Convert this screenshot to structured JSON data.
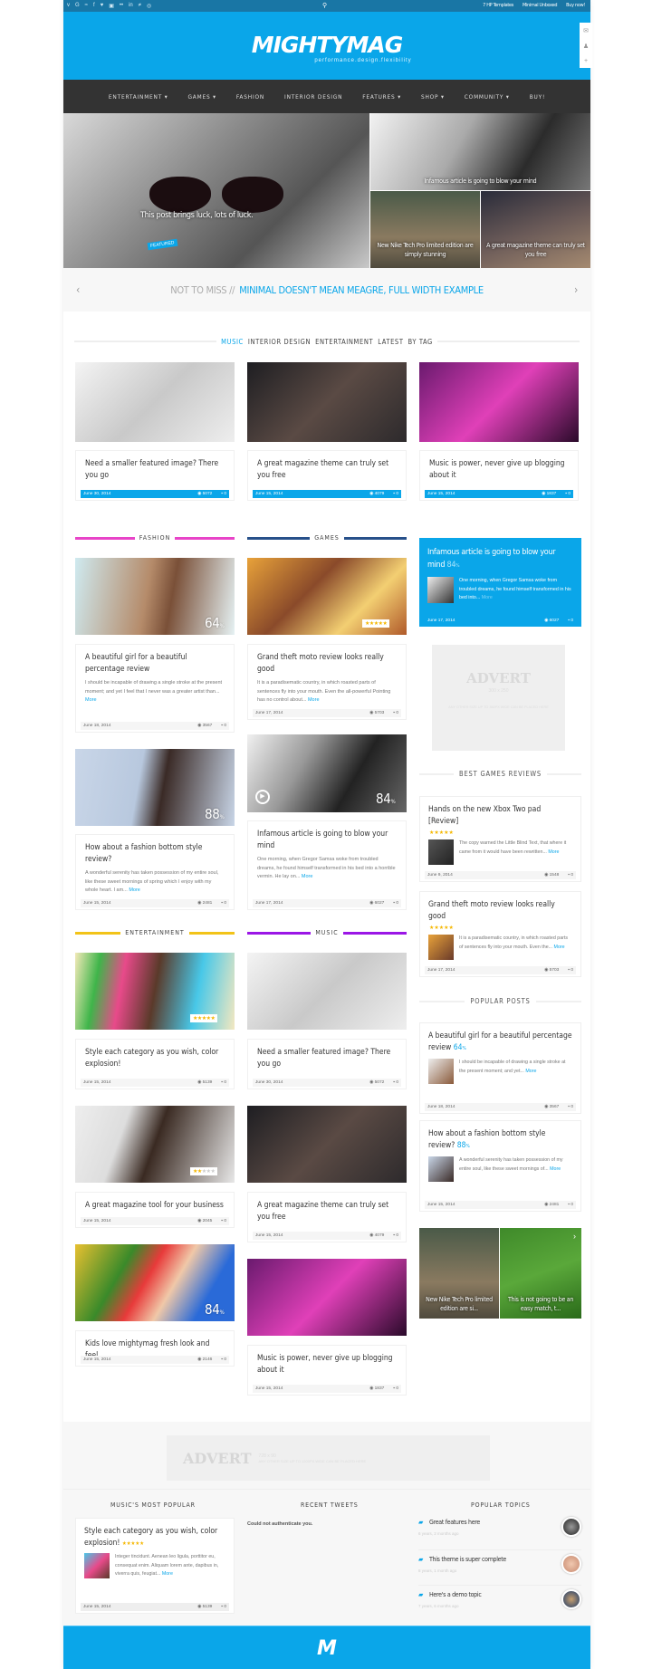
{
  "topbar": {
    "social_icons": [
      "vimeo-icon",
      "google-icon",
      "rss-icon",
      "facebook-icon",
      "twitter-icon",
      "youtube-icon",
      "flickr-icon",
      "linkedin-icon",
      "delicious-icon",
      "dribbble-icon"
    ],
    "links": [
      "7 HP Templates",
      "Minimal Unboxed",
      "Buy now!"
    ]
  },
  "header": {
    "logo": "MIGHTYMAG",
    "tagline": "performance.design.flexibility"
  },
  "nav": [
    "ENTERTAINMENT ▾",
    "GAMES ▾",
    "FASHION",
    "INTERIOR DESIGN",
    "FEATURES ▾",
    "SHOP ▾",
    "COMMUNITY ▾",
    "BUY!"
  ],
  "hero": {
    "main": {
      "badge": "FEATURED",
      "title": "This post brings luck, lots of luck."
    },
    "top_right": "Infamous article is going to blow your mind",
    "bottom_left": "New Nike Tech Pro limited edition are simply stunning",
    "bottom_right": "A great magazine theme can truly set you free"
  },
  "not_to_miss": {
    "label": "NOT TO MISS //",
    "title": "MINIMAL DOESN'T MEAN MEAGRE, FULL WIDTH EXAMPLE"
  },
  "tabs": [
    {
      "label": "MUSIC",
      "active": true
    },
    {
      "label": "INTERIOR DESIGN"
    },
    {
      "label": "ENTERTAINMENT"
    },
    {
      "label": "LATEST"
    },
    {
      "label": "BY TAG"
    }
  ],
  "tab_cards": [
    {
      "title": "Need a smaller featured image? There you go",
      "date": "June 30, 2014",
      "views": "5072",
      "comments": "0"
    },
    {
      "title": "A great magazine theme can truly set you free",
      "date": "June 15, 2014",
      "views": "4079",
      "comments": "0"
    },
    {
      "title": "Music is power, never give up blogging about it",
      "date": "June 15, 2014",
      "views": "1837",
      "comments": "0"
    }
  ],
  "sections": {
    "fashion": {
      "label": "FASHION",
      "color": "#e844c8"
    },
    "games": {
      "label": "GAMES",
      "color": "#27508a"
    },
    "entertainment": {
      "label": "ENTERTAINMENT",
      "color": "#f2c318"
    },
    "music": {
      "label": "MUSIC",
      "color": "#9b16e6"
    }
  },
  "posts": {
    "fashion1": {
      "title": "A beautiful girl for a beautiful percentage review",
      "excerpt": "I should be incapable of drawing a single stroke at the present moment; and yet I feel that I never was a greater artist than...",
      "date": "June 18, 2014",
      "views": "3567",
      "comments": "0",
      "score": "64"
    },
    "fashion2": {
      "title": "How about a fashion bottom style review?",
      "excerpt": "A wonderful serenity has taken possession of my entire soul, like these sweet mornings of spring which I enjoy with my whole heart. I am...",
      "date": "June 15, 2014",
      "views": "2481",
      "comments": "0",
      "score": "88"
    },
    "games1": {
      "title": "Grand theft moto review looks really good",
      "excerpt": "It is a paradisematic country, in which roasted parts of sentences fly into your mouth. Even the all-powerful Pointing has no control about...",
      "date": "June 17, 2014",
      "views": "5703",
      "comments": "0",
      "stars": 4.5
    },
    "games2": {
      "title": "Infamous article is going to blow your mind",
      "excerpt": "One morning, when Gregor Samsa woke from troubled dreams, he found himself transformed in his bed into a horrible vermin. He lay on...",
      "date": "June 17, 2014",
      "views": "6027",
      "comments": "0",
      "score": "84"
    },
    "ent1": {
      "title": "Style each category as you wish, color explosion!",
      "date": "June 15, 2014",
      "views": "5139",
      "comments": "0",
      "stars": 5
    },
    "ent2": {
      "title": "A great magazine tool for your business",
      "date": "June 15, 2014",
      "views": "2045",
      "comments": "0",
      "stars": 2
    },
    "ent3": {
      "title": "Kids love mightymag fresh look and feel",
      "date": "June 15, 2014",
      "views": "2146",
      "comments": "0",
      "score": "84"
    },
    "music1": {
      "title": "Need a smaller featured image? There you go",
      "date": "June 30, 2014",
      "views": "5072",
      "comments": "0"
    },
    "music2": {
      "title": "A great magazine theme can truly set you free",
      "date": "June 15, 2014",
      "views": "4079",
      "comments": "0"
    },
    "music3": {
      "title": "Music is power, never give up blogging about it",
      "date": "June 15, 2014",
      "views": "1837",
      "comments": "0"
    }
  },
  "more_label": "More",
  "pct_sign": "%",
  "sidebar": {
    "featured": {
      "title": "Infamous article is going to blow your mind",
      "score": "84",
      "excerpt": "One morning, when Gregor Samsa woke from troubled dreams, he found himself transformed in his bed into...",
      "date": "June 17, 2014",
      "views": "6027",
      "comments": "0"
    },
    "advert": {
      "title": "ADVERT",
      "size": "300 x 250",
      "note": "ANY OTHER SIZE UP TO 360PX WIDE CAN BE PLACED HERE"
    },
    "best_games_title": "BEST GAMES REVIEWS",
    "best_games": [
      {
        "title": "Hands on the new Xbox Two pad [Review]",
        "stars": 4.5,
        "excerpt": "The copy warned the Little Blind Text, that where it came from it would have been rewritten...",
        "date": "June 9, 2014",
        "views": "1548",
        "comments": "0"
      },
      {
        "title": "Grand theft moto review looks really good",
        "stars": 4.5,
        "excerpt": "It is a paradisematic country, in which roasted parts of sentences fly into your mouth. Even the...",
        "date": "June 17, 2014",
        "views": "5703",
        "comments": "0"
      }
    ],
    "popular_title": "POPULAR POSTS",
    "popular": [
      {
        "title": "A beautiful girl for a beautiful percentage review",
        "score": "64",
        "excerpt": "I should be incapable of drawing a single stroke at the present moment; and yet...",
        "date": "June 18, 2014",
        "views": "3567",
        "comments": "0"
      },
      {
        "title": "How about a fashion bottom style review?",
        "score": "88",
        "excerpt": "A wonderful serenity has taken possession of my entire soul, like these sweet mornings of...",
        "date": "June 15, 2014",
        "views": "2481",
        "comments": "0"
      }
    ],
    "slider": [
      "New Nike Tech Pro limited edition are si...",
      "This is not going to be an easy match, t..."
    ]
  },
  "leaderboard": {
    "title": "ADVERT",
    "size": "728 x 90",
    "note": "ANY OTHER SIZE UP TO 1200PX WIDE CAN BE PLACED HERE"
  },
  "footer": {
    "col1": {
      "title": "MUSIC'S MOST POPULAR",
      "post": {
        "title": "Style each category as you wish, color explosion!",
        "stars": 5,
        "excerpt": "Integer tincidunt. Aenean leo ligula, porttitor eu, consequat enim. Aliquam lorem ante, dapibus in, viverra quis, feugiat...",
        "date": "June 15, 2014",
        "views": "5139",
        "comments": "0"
      }
    },
    "col2": {
      "title": "RECENT TWEETS",
      "message": "Could not authenticate you."
    },
    "col3": {
      "title": "POPULAR TOPICS",
      "topics": [
        {
          "title": "Great features here",
          "time": "6 years, 2 months ago"
        },
        {
          "title": "This theme is super complete",
          "time": "8 years, 1 month ago"
        },
        {
          "title": "Here's a demo topic",
          "time": "7 years, 6 months ago"
        }
      ]
    },
    "logo": "M"
  }
}
